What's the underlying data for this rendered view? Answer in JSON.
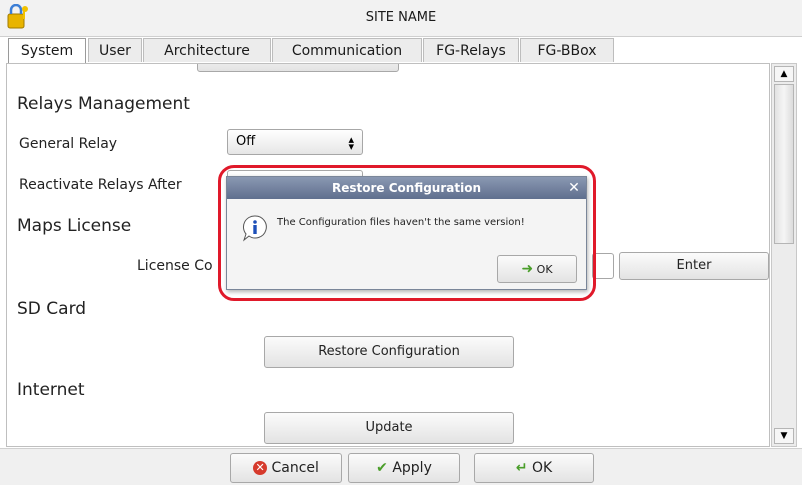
{
  "window": {
    "title": "SITE NAME",
    "app_icon": "lock-key-icon"
  },
  "tabs": [
    {
      "label": "System",
      "active": true
    },
    {
      "label": "User",
      "active": false
    },
    {
      "label": "Architecture",
      "active": false
    },
    {
      "label": "Communication",
      "active": false
    },
    {
      "label": "FG-Relays",
      "active": false
    },
    {
      "label": "FG-BBox",
      "active": false
    }
  ],
  "content": {
    "relays_heading": "Relays Management",
    "general_relay_label": "General Relay",
    "general_relay_value": "Off",
    "reactivate_label": "Reactivate Relays After",
    "maps_heading": "Maps License",
    "license_code_label": "License Co",
    "enter_label": "Enter",
    "sd_heading": "SD Card",
    "restore_label": "Restore Configuration",
    "internet_heading": "Internet",
    "update_label": "Update"
  },
  "dialog": {
    "title": "Restore Configuration",
    "message": "The Configuration files haven't the same version!",
    "ok_label": "OK",
    "close_icon": "close-icon",
    "info_icon": "info-icon"
  },
  "footer": {
    "cancel_label": "Cancel",
    "apply_label": "Apply",
    "ok_label": "OK"
  },
  "colors": {
    "highlight": "#e0192a",
    "dialog_title": "#6b7a98"
  }
}
